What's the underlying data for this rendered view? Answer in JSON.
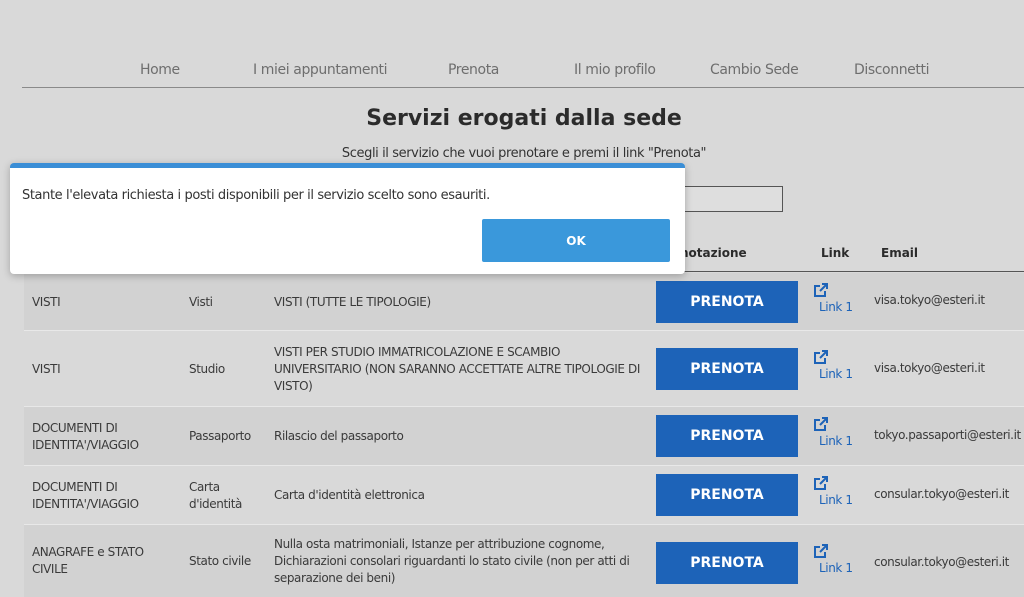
{
  "nav": {
    "items": [
      "Home",
      "I miei appuntamenti",
      "Prenota",
      "Il mio profilo",
      "Cambio Sede",
      "Disconnetti"
    ]
  },
  "page": {
    "title": "Servizi erogati dalla sede",
    "subtitle": "Scegli il servizio che vuoi prenotare e premi il link \"Prenota\""
  },
  "table": {
    "headers": {
      "prenotazione": "notazione",
      "link": "Link",
      "email": "Email"
    },
    "rows": [
      {
        "tipologia": "VISTI",
        "servizio": "Visti",
        "descrizione": "VISTI (TUTTE LE TIPOLOGIE)",
        "button": "PRENOTA",
        "link": "Link 1",
        "email": "visa.tokyo@esteri.it"
      },
      {
        "tipologia": "VISTI",
        "servizio": "Studio",
        "descrizione": "VISTI PER STUDIO IMMATRICOLAZIONE E SCAMBIO UNIVERSITARIO (NON SARANNO ACCETTATE ALTRE TIPOLOGIE DI VISTO)",
        "button": "PRENOTA",
        "link": "Link 1",
        "email": "visa.tokyo@esteri.it"
      },
      {
        "tipologia": "DOCUMENTI DI IDENTITA'/VIAGGIO",
        "servizio": "Passaporto",
        "descrizione": "Rilascio del passaporto",
        "button": "PRENOTA",
        "link": "Link 1",
        "email": "tokyo.passaporti@esteri.it"
      },
      {
        "tipologia": "DOCUMENTI DI IDENTITA'/VIAGGIO",
        "servizio": "Carta d'identità",
        "descrizione": "Carta d'identità elettronica",
        "button": "PRENOTA",
        "link": "Link 1",
        "email": "consular.tokyo@esteri.it"
      },
      {
        "tipologia": "ANAGRAFE e STATO CIVILE",
        "servizio": "Stato civile",
        "descrizione": "Nulla osta matrimoniali, Istanze per attribuzione cognome, Dichiarazioni consolari riguardanti lo stato civile (non per atti di separazione dei beni)",
        "button": "PRENOTA",
        "link": "Link 1",
        "email": "consular.tokyo@esteri.it"
      }
    ]
  },
  "modal": {
    "message": "Stante l'elevata richiesta i posti disponibili per il servizio scelto sono esauriti.",
    "ok_label": "OK"
  },
  "icons": {
    "link": "external-link-icon"
  },
  "colors": {
    "accent": "#1d63b8",
    "modal_border": "#3a8ed6",
    "ok_button": "#3a98db"
  }
}
